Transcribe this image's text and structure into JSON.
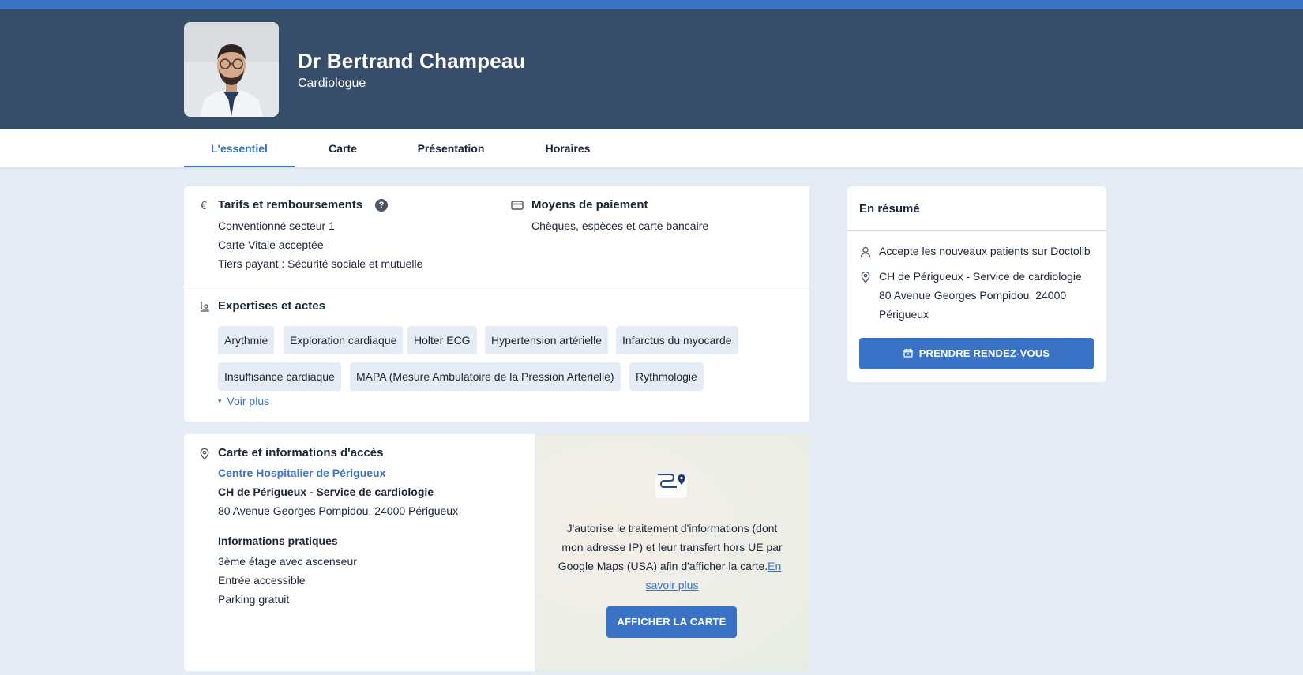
{
  "doctor": {
    "name": "Dr Bertrand Champeau",
    "specialty": "Cardiologue"
  },
  "tabs": [
    {
      "label": "L'essentiel",
      "active": true
    },
    {
      "label": "Carte",
      "active": false
    },
    {
      "label": "Présentation",
      "active": false
    },
    {
      "label": "Horaires",
      "active": false
    }
  ],
  "tarifs": {
    "title": "Tarifs et remboursements",
    "help": "?",
    "lines": [
      "Conventionné secteur 1",
      "Carte Vitale acceptée",
      "Tiers payant : Sécurité sociale et mutuelle"
    ]
  },
  "paiement": {
    "title": "Moyens de paiement",
    "text": "Chèques, espèces et carte bancaire"
  },
  "expertises": {
    "title": "Expertises et actes",
    "chips": [
      "Arythmie",
      "Exploration cardiaque",
      "Holter ECG",
      "Hypertension artérielle",
      "Infarctus du myocarde",
      "Insuffisance cardiaque",
      "MAPA (Mesure Ambulatoire de la Pression Artérielle)",
      "Rythmologie"
    ],
    "more_caret": "▾",
    "more_label": "Voir plus"
  },
  "acces": {
    "title": "Carte et informations d'accès",
    "center_link": "Centre Hospitalier de Périgueux",
    "service": "CH de Périgueux - Service de cardiologie",
    "address": "80 Avenue Georges Pompidou, 24000 Périgueux",
    "practical_title": "Informations pratiques",
    "practical": [
      "3ème étage avec ascenseur",
      "Entrée accessible",
      "Parking gratuit"
    ]
  },
  "map": {
    "consent_lines": [
      "J'autorise le traitement d'informations (dont",
      "mon adresse IP) et leur transfert hors UE par",
      "Google Maps (USA) afin d'afficher la carte."
    ],
    "learn_more_1": "En",
    "learn_more_2": "savoir plus",
    "button": "AFFICHER LA CARTE"
  },
  "resume": {
    "title": "En résumé",
    "new_patients": "Accepte les nouveaux patients sur Doctolib",
    "address_lines": [
      "CH de Périgueux - Service de cardiologie",
      "80 Avenue Georges Pompidou, 24000",
      "Périgueux"
    ],
    "button": "PRENDRE RENDEZ-VOUS"
  },
  "colors": {
    "header": "#374e6b",
    "accent": "#3a73c6",
    "background": "#e5ecf5"
  }
}
